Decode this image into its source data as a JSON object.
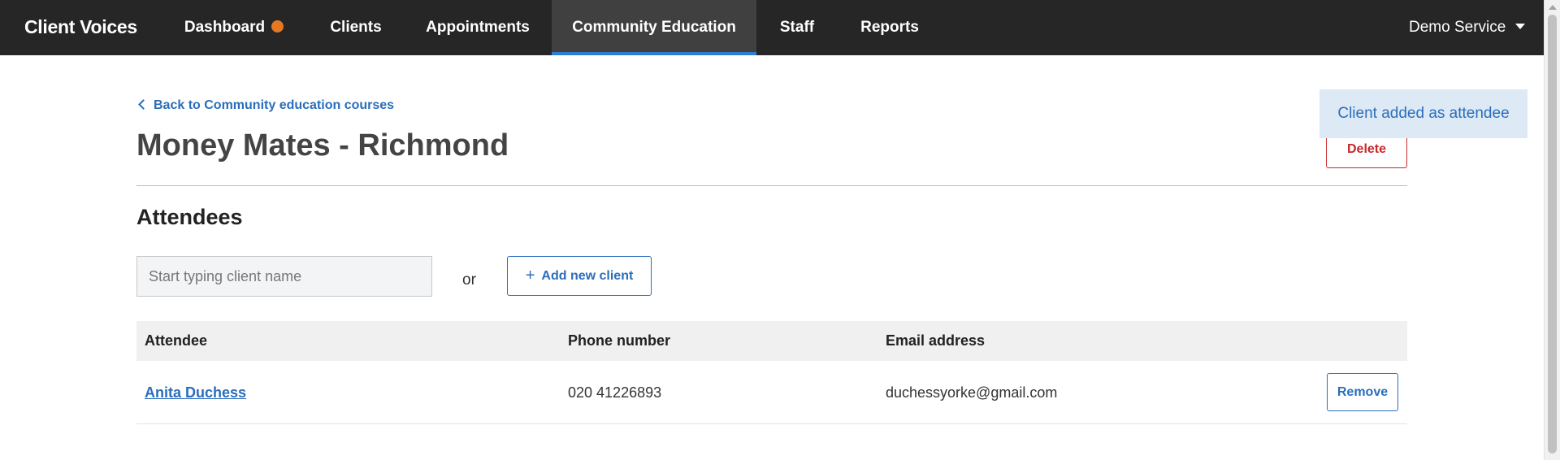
{
  "nav": {
    "brand": "Client Voices",
    "items": [
      {
        "label": "Dashboard",
        "has_badge": true
      },
      {
        "label": "Clients"
      },
      {
        "label": "Appointments"
      },
      {
        "label": "Community Education",
        "active": true
      },
      {
        "label": "Staff"
      },
      {
        "label": "Reports"
      }
    ],
    "account_label": "Demo Service",
    "badge_color": "#e87722",
    "active_indicator_color": "#2e7dd1"
  },
  "page": {
    "back_link": "Back to Community education courses",
    "title": "Money Mates - Richmond",
    "delete_label": "Delete",
    "toast": "Client added as attendee"
  },
  "attendees": {
    "heading": "Attendees",
    "search_placeholder": "Start typing client name",
    "search_value": "",
    "or_text": "or",
    "add_label": "Add new client",
    "columns": [
      "Attendee",
      "Phone number",
      "Email address"
    ],
    "rows": [
      {
        "name": "Anita Duchess",
        "phone": "020 41226893",
        "email": "duchessyorke@gmail.com",
        "action": "Remove"
      }
    ]
  },
  "colors": {
    "navbar": "#262626",
    "link": "#2a6ebb",
    "danger": "#c6282d",
    "toast_bg": "#dde9f5"
  }
}
